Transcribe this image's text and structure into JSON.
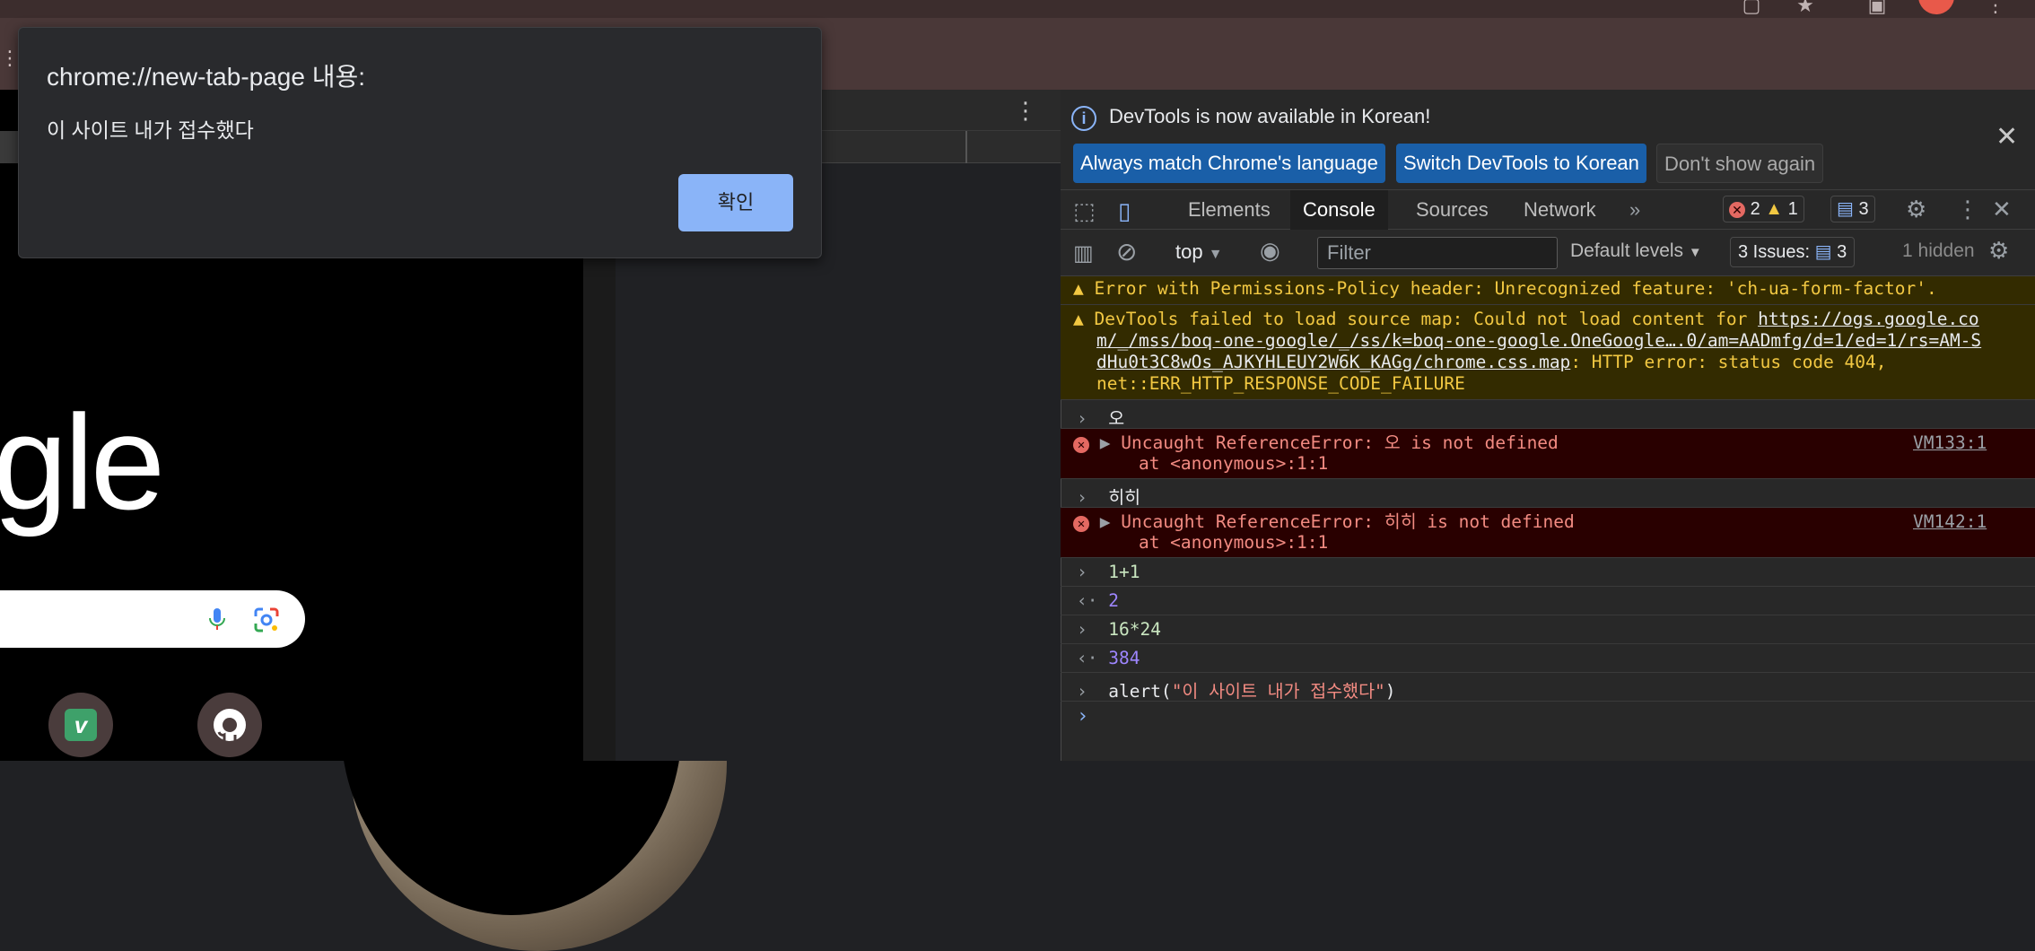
{
  "dialog": {
    "title": "chrome://new-tab-page 내용:",
    "message": "이 사이트 내가 접수했다",
    "ok_label": "확인"
  },
  "page": {
    "logo_text": "gle",
    "shortcut_v_letter": "v"
  },
  "browser": {
    "overflow_label": "⋮"
  },
  "devtools": {
    "infobar": {
      "text": "DevTools is now available in Korean!",
      "btn_match": "Always match Chrome's language",
      "btn_switch": "Switch DevTools to Korean",
      "btn_dont": "Don't show again"
    },
    "tabs": {
      "elements": "Elements",
      "console": "Console",
      "sources": "Sources",
      "network": "Network",
      "more": "»"
    },
    "badges": {
      "errors": "2",
      "warnings": "1",
      "messages": "3"
    },
    "filterbar": {
      "context": "top",
      "filter_placeholder": "Filter",
      "levels": "Default levels",
      "issues_label": "3 Issues:",
      "issues_count": "3",
      "hidden": "1 hidden"
    },
    "console": {
      "warn1": "Error with Permissions-Policy header: Unrecognized feature: 'ch-ua-form-factor'.",
      "warn2_prefix": "DevTools failed to load source map: Could not load content for ",
      "warn2_link_1": "https://ogs.google.co",
      "warn2_link_2": "m/_/mss/boq-one-google/_/ss/k=boq-one-google.OneGoogle….0/am=AADmfg/d=1/ed=1/rs=AM-S",
      "warn2_link_3": "dHu0t3C8wOs_AJKYHLEUY2W6K_KAGg/chrome.css.map",
      "warn2_suffix": ": HTTP error: status code 404,",
      "warn2_line4": "net::ERR_HTTP_RESPONSE_CODE_FAILURE",
      "input1": "오",
      "err1": "Uncaught ReferenceError: 오 is not defined",
      "err1_at": "    at <anonymous>:1:1",
      "err1_ref": "VM133:1",
      "input2": "히히",
      "err2": "Uncaught ReferenceError: 히히 is not defined",
      "err2_at": "    at <anonymous>:1:1",
      "err2_ref": "VM142:1",
      "input3": "1+1",
      "output3": "2",
      "input4": "16*24",
      "output4": "384",
      "input5_fn": "alert(",
      "input5_str": "\"이 사이트 내가 접수했다\"",
      "input5_end": ")"
    }
  }
}
